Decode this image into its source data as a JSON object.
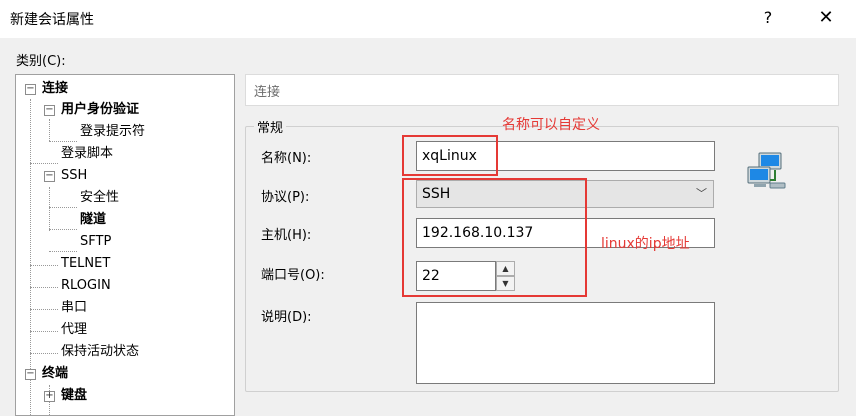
{
  "window": {
    "title": "新建会话属性",
    "help_label": "?",
    "close_label": "✕"
  },
  "category_label": "类别(C):",
  "tree": [
    {
      "label": "连接"
    },
    {
      "label": "用户身份验证"
    },
    {
      "label": "登录提示符"
    },
    {
      "label": "登录脚本"
    },
    {
      "label": "SSH"
    },
    {
      "label": "安全性"
    },
    {
      "label": "隧道"
    },
    {
      "label": "SFTP"
    },
    {
      "label": "TELNET"
    },
    {
      "label": "RLOGIN"
    },
    {
      "label": "串口"
    },
    {
      "label": "代理"
    },
    {
      "label": "保持活动状态"
    },
    {
      "label": "终端"
    },
    {
      "label": "键盘"
    }
  ],
  "section_header": "连接",
  "group_title": "常规",
  "fields": {
    "name_label": "名称(N):",
    "name_value": "xqLinux",
    "protocol_label": "协议(P):",
    "protocol_value": "SSH",
    "host_label": "主机(H):",
    "host_value": "192.168.10.137",
    "port_label": "端口号(O):",
    "port_value": "22",
    "description_label": "说明(D):",
    "description_value": ""
  },
  "annotations": {
    "name_note": "名称可以自定义",
    "ip_note": "linux的ip地址"
  },
  "colors": {
    "annotation": "#e53935",
    "selected_tree_bg": "#ffffff"
  },
  "icons": {
    "network": "network-computers-icon",
    "spinner_up": "spinner-up-icon",
    "spinner_down": "spinner-down-icon"
  }
}
